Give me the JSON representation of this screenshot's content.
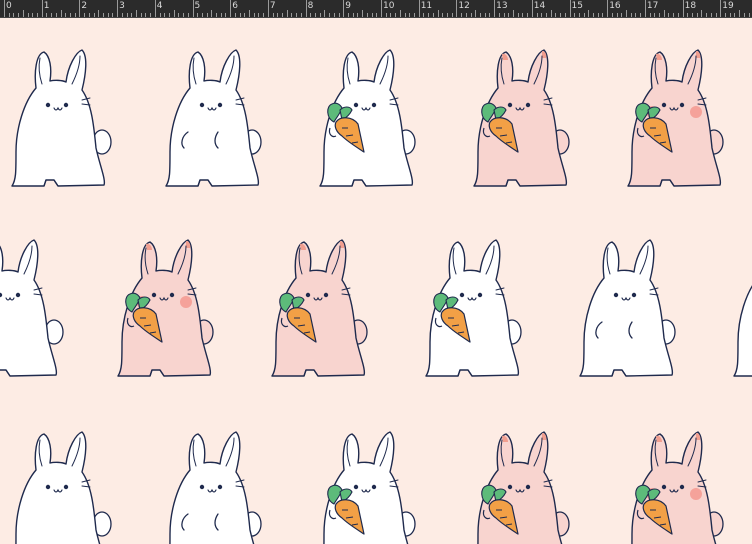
{
  "ruler": {
    "labels": [
      "0",
      "1",
      "2",
      "3",
      "4",
      "5",
      "6",
      "7",
      "8",
      "9",
      "10",
      "11",
      "12",
      "13",
      "14",
      "15",
      "16",
      "17",
      "18",
      "19"
    ]
  },
  "colors": {
    "background": "#fdece4",
    "outline": "#1f2a4d",
    "bunny_white": "#ffffff",
    "bunny_pink": "#f8d4cf",
    "ear_tip": "#f19e8f",
    "blush": "#f5a29a",
    "carrot": "#f2a046",
    "carrot_leaf": "#5dbb7a"
  },
  "pattern": {
    "rows": [
      [
        "plain-white",
        "paws-white",
        "carrot-white",
        "carrot-pink",
        "carrot-pink-blush"
      ],
      [
        "plain-white",
        "carrot-pink-blush",
        "carrot-pink",
        "carrot-white",
        "paws-white",
        "plain-white"
      ],
      [
        "plain-white",
        "paws-white",
        "carrot-white",
        "carrot-pink",
        "carrot-pink-blush"
      ]
    ]
  }
}
